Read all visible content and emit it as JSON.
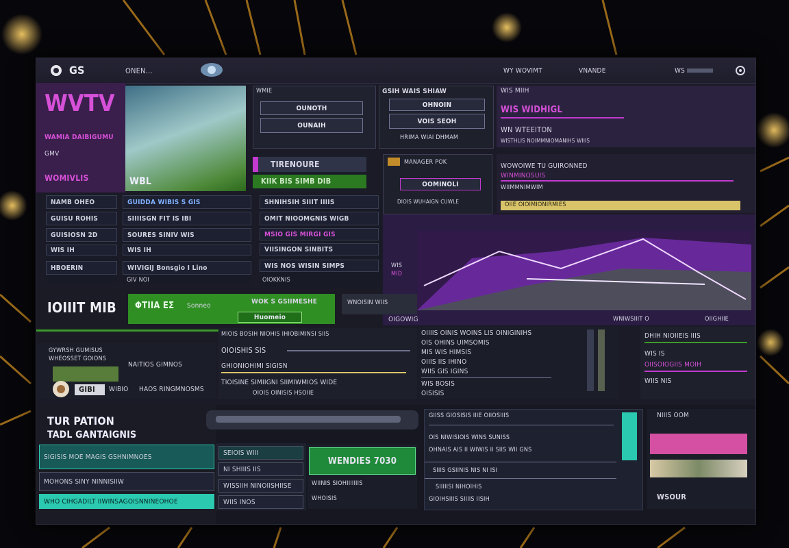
{
  "topbar": {
    "logo": "GS",
    "menu_label": "ONEN...",
    "nav_1": "WY WOVIMT",
    "nav_2": "VNANDE",
    "nav_3": "WS"
  },
  "hero": {
    "title": "WVTV",
    "sub_1": "WAMIA DAIBIGUMU",
    "sub_2": "GMV",
    "sub_3": "WOMIVLIS",
    "image_caption": "WBL"
  },
  "login_panel": {
    "label": "WMIE",
    "field_1": "OUNOTH",
    "field_2": "OUNAIH"
  },
  "search_panel": {
    "label": "GSIH  WAIS SHIAW",
    "line_1": "OHNOIN",
    "line_2": "VOIS  SEOH",
    "line_3": "HRIMA WIAI DHMAM"
  },
  "info_panel": {
    "line_1": "WIS MIIH",
    "line_2": "WIS  WIDHIGL",
    "line_3": "WN  WTEEITON",
    "line_4": "WISTHLIS NOIMMNIOMANIHS WIIIS"
  },
  "tag_panel": {
    "title": "TIRENOURE",
    "sub": "KIIK  BIS  SIMB  DIB"
  },
  "mini_panel": {
    "label": "MANAGER POK",
    "button": "OOMINOLI",
    "sub": "DIOIS WUHAIGN CUWLE"
  },
  "alert_panel": {
    "line_1": "WOWOIWE TU GUIRONNED",
    "line_2": "WINMINOSUIS",
    "line_3": "WIIMMNIMWIM",
    "bar": "OIIE OIOIMIONIRMIES"
  },
  "list_left": {
    "items": [
      "NAMB OHEO",
      "GUISU ROHIS",
      "GUISIOSN 2D",
      "WIS IH",
      "HBOERIN"
    ]
  },
  "list_mid": {
    "items": [
      "GUIDDA  WIBIS S GIS",
      "SIIIISGN FIT IS IBI",
      "SOURES  SINIV  WIS",
      "WIS IH",
      "WIVIGIJ  Bonsgio I  Lino",
      "GIV  NOI"
    ]
  },
  "list_right": {
    "items": [
      "SHNIHSIH SIIIT IIIIS",
      "OMIT  NIOOMGNIS  WIGB",
      "MSIO  GIS  MIRGI  GIS",
      "VIISINGON SINBITS",
      "WIS NOS  WISIN SIMPS",
      "OIOKKNIS"
    ]
  },
  "chart": {
    "side_1": "WIS",
    "side_2": "MID",
    "legend": "OIGOWIG",
    "ctrl_1": "WNIWSIIIT O",
    "ctrl_2": "OIIGHIIE"
  },
  "banner": {
    "title": "IOIIIT  MIB",
    "badge": "ΦΤΙΙΑ ΕΣ",
    "badge_sub": "Sonneo",
    "green_1": "WOK S GSIIMESHE",
    "green_2": "Huomeio",
    "side": "WNOISIN WIIS"
  },
  "profile": {
    "line_1": "GYWRSH  GUMISUS",
    "line_2": "WHEOSSET  GOIONS",
    "tag": "GIBI",
    "name": "WIBIO",
    "mid": "NAITIOS  GIMNOS",
    "bottom": "HAOS RINGMNOSMS"
  },
  "feed": {
    "line_1": "MIOIS  BOSIH  NIOHIS  IHIOBIMINSI  SIIS",
    "line_2": "OIOISHIS  SIS",
    "line_3": "GHIONIOHIMI  SIGISN",
    "line_4": "TIOISINE  SIMIIGNI  SIIMIWMIOS  WIDE",
    "line_5": "OIOIS  OINISIS  HSOIIE"
  },
  "desc": {
    "line_1": "OIIIIS  OINIS  WOINS  LIS  OINIGINIHS",
    "line_2": "OIS  OHINS  UIMSOMIS",
    "line_3": "MIS  WIS  HIMSIS",
    "line_4": "OIIIS  IIS  IHINO",
    "line_5": "WIIS  GIS  IGINS",
    "line_6": "WIS  BOSIS",
    "line_7": "OISISIS"
  },
  "stats": {
    "line_1": "DHIH  NIOIIEIS  IIIS",
    "line_2": "WIS  IS",
    "line_3": "OIISOIOGIIS  MOIH",
    "line_4": "WIIS  NIS"
  },
  "bottom_left": {
    "title_1": "TUR PATION",
    "title_2": "TADL GANTAIGNIS",
    "row_1": "SIGISIS MOE MAGIS GSHNIMNOES",
    "row_2": "MOHONS  SINY NINNISIIW",
    "row_3": "WHO CIHGADILT IIWINSAGOISNNINEOHOE"
  },
  "bottom_mid": {
    "field_1": "SEIOIS WIII",
    "field_2": "NI SHIIIS IIS",
    "field_3": "WISSIIH NINOIISHIISE",
    "field_4": "WIIS INOS",
    "cta": "WENDIES 7030",
    "cta_sub_1": "WIINIS  SIOHIIIIIIIS",
    "cta_sub_2": "WHOISIS"
  },
  "bottom_right": {
    "line_1": "GIISS  GIOSISIS  IIIE  OIIOSIIIS",
    "line_2": "OIS  NIWISIOIS  WINS  SUNISS",
    "line_3": "OHNAIS  AIS  II  WIWIS  II  SIIS  WII  GNS",
    "line_4": "SIIIS  GSIINIS  NIS  NI  ISI",
    "line_5": "SIIIIISI  NIHOIHIS",
    "line_6": "GIOIHSIIIS  SIIIIS  IISIH",
    "side_title": "NIIIS OOM",
    "side_footer": "WSOUR"
  },
  "colors": {
    "purple": "#c23ad0",
    "green": "#3c9a2a",
    "teal": "#2bc9b0",
    "yellow": "#d9c46a",
    "pink": "#d54fa2"
  }
}
